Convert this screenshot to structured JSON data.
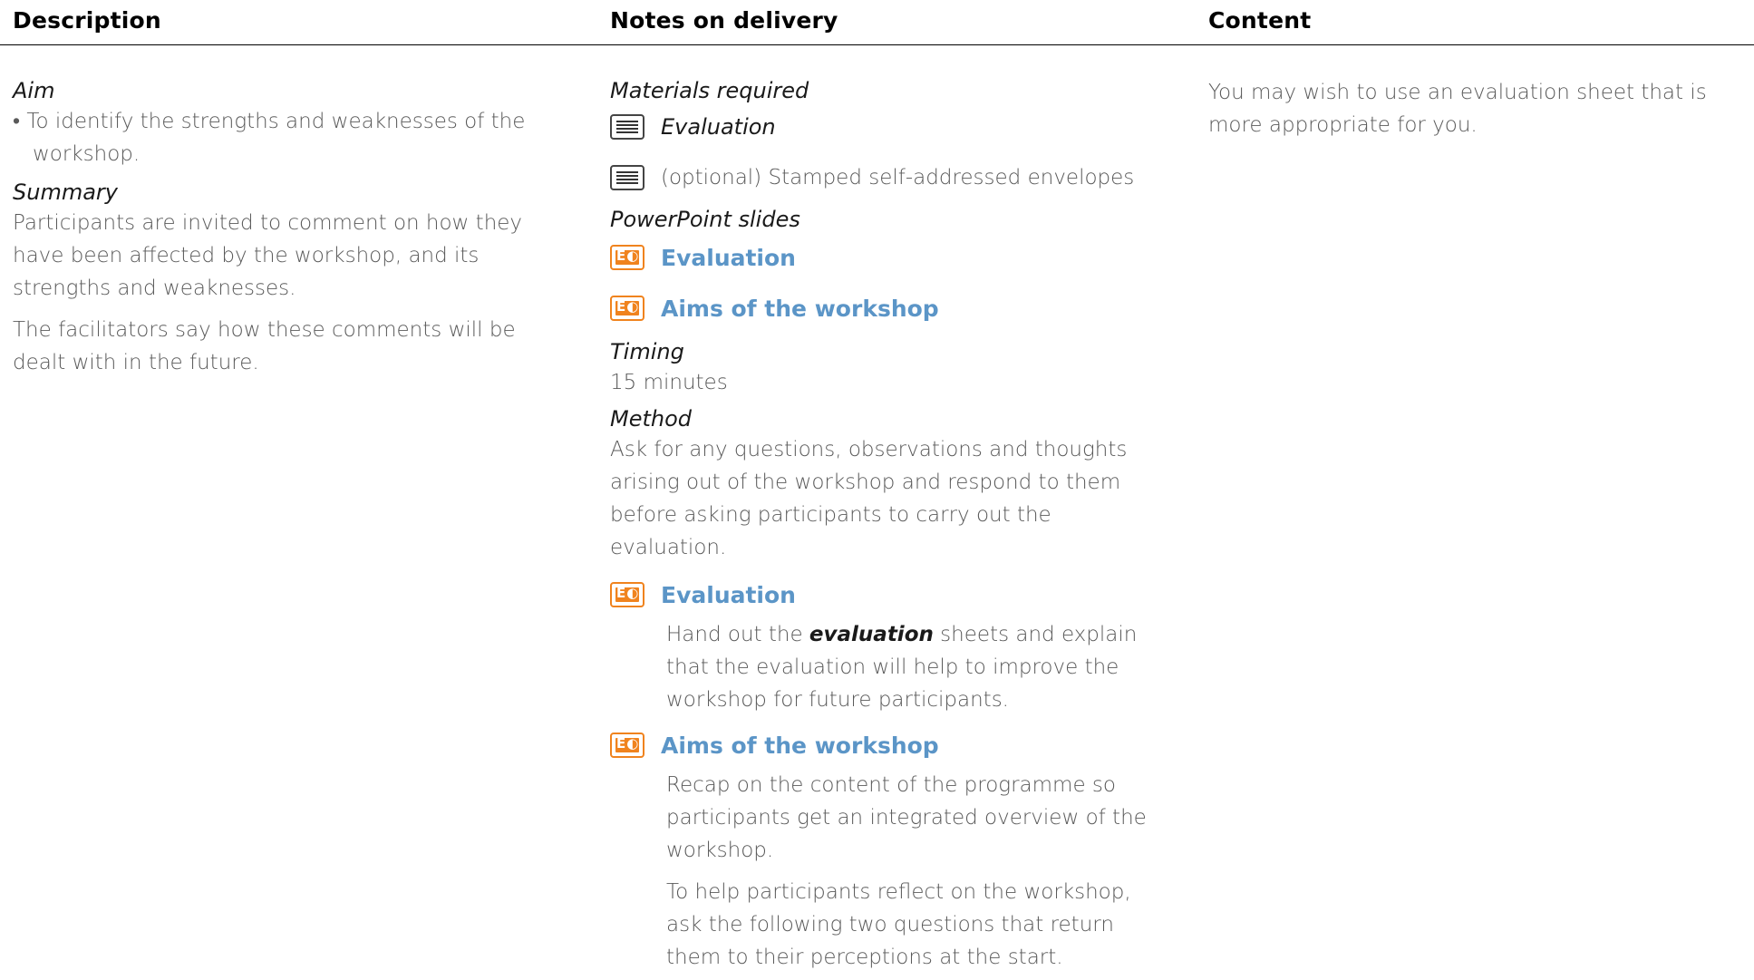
{
  "headers": {
    "description": "Description",
    "notes": "Notes on delivery",
    "content": "Content"
  },
  "description": {
    "aim_heading": "Aim",
    "aim_bullet": "• To identify the strengths and weaknesses of the workshop.",
    "summary_heading": "Summary",
    "summary_p1": "Participants are invited to comment on how they have been affected by the workshop, and its strengths and weaknesses.",
    "summary_p2": "The facilitators say how these comments will be dealt with in the future."
  },
  "notes": {
    "materials_heading": "Materials required",
    "materials": [
      {
        "label": "Evaluation",
        "icon": "handout-icon"
      },
      {
        "label": "(optional) Stamped self-addressed envelopes",
        "icon": "handout-icon"
      }
    ],
    "slides_heading": "PowerPoint slides",
    "slides": [
      {
        "label": "Evaluation",
        "icon": "slide-icon"
      },
      {
        "label": "Aims of the workshop",
        "icon": "slide-icon"
      }
    ],
    "timing_heading": "Timing",
    "timing_value": "15 minutes",
    "method_heading": "Method",
    "method_p1": "Ask for any questions, observations and thoughts arising out of the workshop and respond to them before asking participants to carry out the evaluation.",
    "method_slide1": "Evaluation",
    "method_slide1_before": "Hand out the ",
    "method_slide1_em": "evaluation",
    "method_slide1_after": " sheets and explain that the evaluation will help to improve the workshop for future participants.",
    "method_slide2": "Aims of the workshop",
    "method_slide2_p1": "Recap on the content of the programme so participants get an integrated overview of the workshop.",
    "method_slide2_p2": "To help participants reflect on the workshop, ask the following two questions that return them to their perceptions at the start."
  },
  "content": {
    "p1": "You may wish to use an evaluation sheet that is more appropriate for you."
  },
  "colors": {
    "link_blue": "#5b95c7",
    "slide_orange": "#f0831e"
  }
}
